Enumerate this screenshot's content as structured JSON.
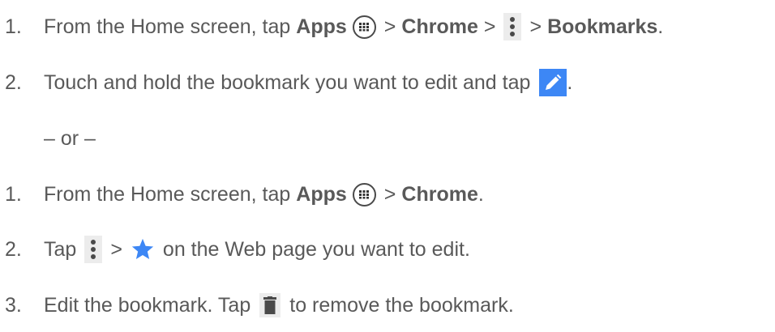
{
  "section1": {
    "step1": {
      "num": "1.",
      "text_a": "From the Home screen, tap",
      "apps": "Apps",
      "gt1": ">",
      "chrome": "Chrome",
      "gt2": ">",
      "gt3": ">",
      "bookmarks": "Bookmarks",
      "end": "."
    },
    "step2": {
      "num": "2.",
      "text_a": "Touch and hold the bookmark you want to edit and tap",
      "end": "."
    }
  },
  "or_text": "– or –",
  "section2": {
    "step1": {
      "num": "1.",
      "text_a": "From the Home screen, tap",
      "apps": "Apps",
      "gt1": ">",
      "chrome": "Chrome",
      "end": "."
    },
    "step2": {
      "num": "2.",
      "text_a": "Tap",
      "gt1": ">",
      "text_b": "on the Web page you want to edit."
    },
    "step3": {
      "num": "3.",
      "text_a": "Edit the bookmark. Tap",
      "text_b": "to remove the bookmark."
    }
  },
  "icons": {
    "apps": "apps-grid-icon",
    "menu": "more-vert-icon",
    "edit": "pencil-icon",
    "star": "star-icon",
    "delete": "trash-icon"
  },
  "colors": {
    "text": "#595959",
    "edit_bg": "#3d87f5",
    "star": "#3d87f5"
  }
}
